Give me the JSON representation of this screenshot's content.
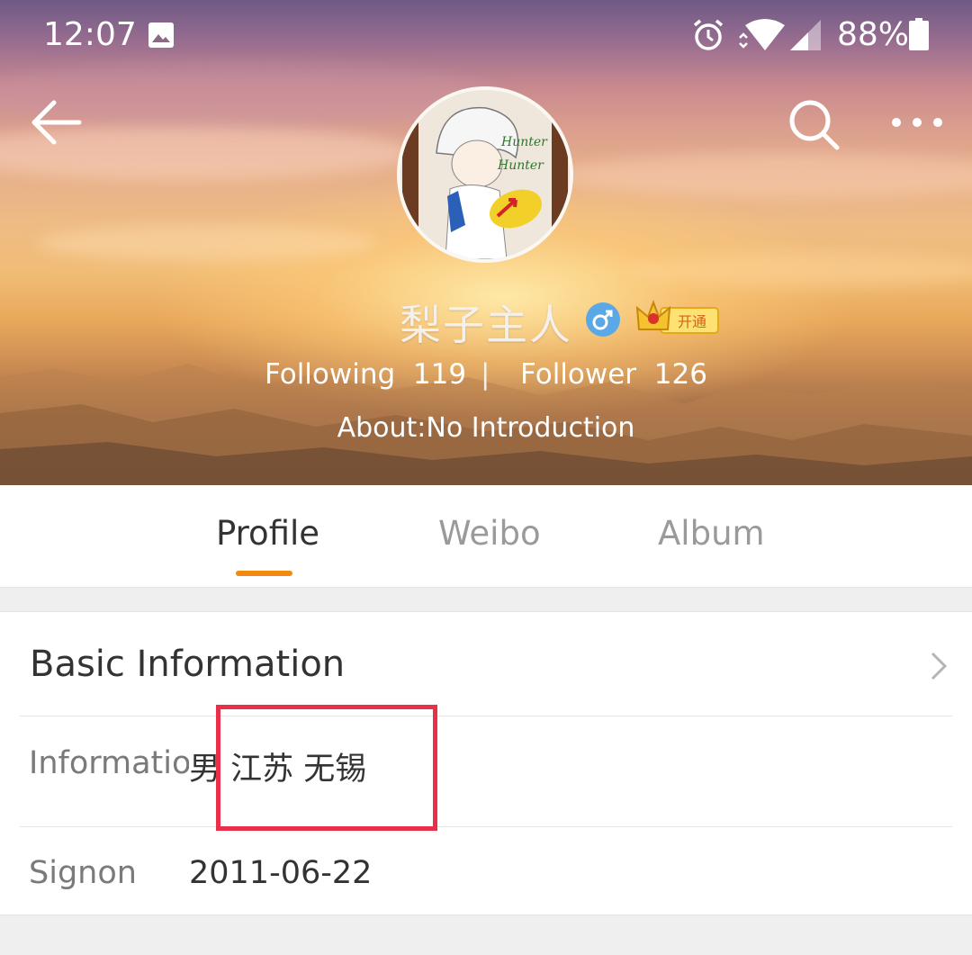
{
  "status_bar": {
    "time": "12:07",
    "battery_percent": "88%",
    "icons": [
      "image-icon",
      "alarm-icon",
      "wifi-icon",
      "signal-icon",
      "battery-icon"
    ]
  },
  "header": {
    "user_name": "梨子主人",
    "gender": "male-icon",
    "vip_badge_text": "开通",
    "following_label": "Following",
    "following_count": "119",
    "separator": "|",
    "follower_label": "Follower",
    "follower_count": "126",
    "about": "About:No Introduction",
    "actions": [
      "back-arrow-icon",
      "search-icon",
      "more-icon"
    ]
  },
  "tabs": [
    {
      "label": "Profile",
      "active": true
    },
    {
      "label": "Weibo",
      "active": false
    },
    {
      "label": "Album",
      "active": false
    }
  ],
  "basic_info": {
    "title": "Basic Information",
    "rows": [
      {
        "label": "Information",
        "value": "男  江苏 无锡"
      },
      {
        "label": "Signon",
        "value": "2011-06-22"
      }
    ]
  },
  "colors": {
    "tab_indicator": "#f28a12",
    "highlight_box": "#e8304a",
    "gender_badge": "#5aa9e6",
    "vip_gold": "#f5c230"
  }
}
